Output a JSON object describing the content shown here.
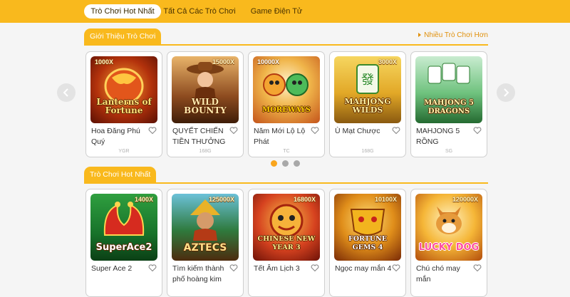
{
  "nav": {
    "tabs": [
      {
        "label": "Trò Chơi Hot Nhất",
        "active": true
      },
      {
        "label": "Tất Cả Các Trò Chơi",
        "active": false
      },
      {
        "label": "Game Điện Tử",
        "active": false
      }
    ]
  },
  "section_intro": {
    "title": "Giới Thiệu Trò Chơi",
    "more_label": "Nhiều Trò Chơi Hơn",
    "cards": [
      {
        "name": "Hoa Đăng Phú Quý",
        "provider": "YGR",
        "art_text": "Lanterns of Fortune",
        "multiplier": "1000X",
        "icon": "dragon-lantern-art"
      },
      {
        "name": "QUYẾT CHIẾN TIỀN THƯỞNG",
        "provider": "168G",
        "art_text": "WILD BOUNTY",
        "multiplier": "15000X",
        "icon": "cowgirl-art"
      },
      {
        "name": "Năm Mới Lộ Lộ Phát",
        "provider": "TC",
        "art_text": "MOREWAYS",
        "multiplier": "10000X",
        "icon": "lion-dance-art"
      },
      {
        "name": "Ù Mạt Chược",
        "provider": "168G",
        "art_text": "MAHJONG WILDS",
        "multiplier": "3000X",
        "icon": "mahjong-tile-art"
      },
      {
        "name": "MAHJONG 5 RỒNG",
        "provider": "SG",
        "art_text": "MAHJONG 5 DRAGONS",
        "multiplier": "",
        "icon": "mahjong-dragons-art"
      }
    ],
    "pagination_count": 3,
    "active_page": 1
  },
  "section_hot": {
    "title": "Trò Chơi Hot Nhất",
    "cards": [
      {
        "name": "Super Ace 2",
        "art_text": "SuperAce2",
        "multiplier": "1400X",
        "icon": "jester-hat-art"
      },
      {
        "name": "Tìm kiếm thành phố hoàng kim",
        "art_text": "AZTECS",
        "multiplier": "125000X",
        "icon": "aztec-princess-art"
      },
      {
        "name": "Tết Âm Lịch 3",
        "art_text": "CHINESE NEW YEAR 3",
        "multiplier": "16800X",
        "icon": "lion-head-art"
      },
      {
        "name": "Ngọc may mắn 4",
        "art_text": "FORTUNE GEMS 4",
        "multiplier": "10100X",
        "icon": "golden-mask-art"
      },
      {
        "name": "Chú chó may mắn",
        "art_text": "LUCKY DOG",
        "multiplier": "120000X",
        "icon": "shiba-dog-art"
      }
    ]
  },
  "colors": {
    "brand": "#f9b91d",
    "active_dot": "#f9a51d",
    "heart_outline": "#8a8a8a"
  }
}
